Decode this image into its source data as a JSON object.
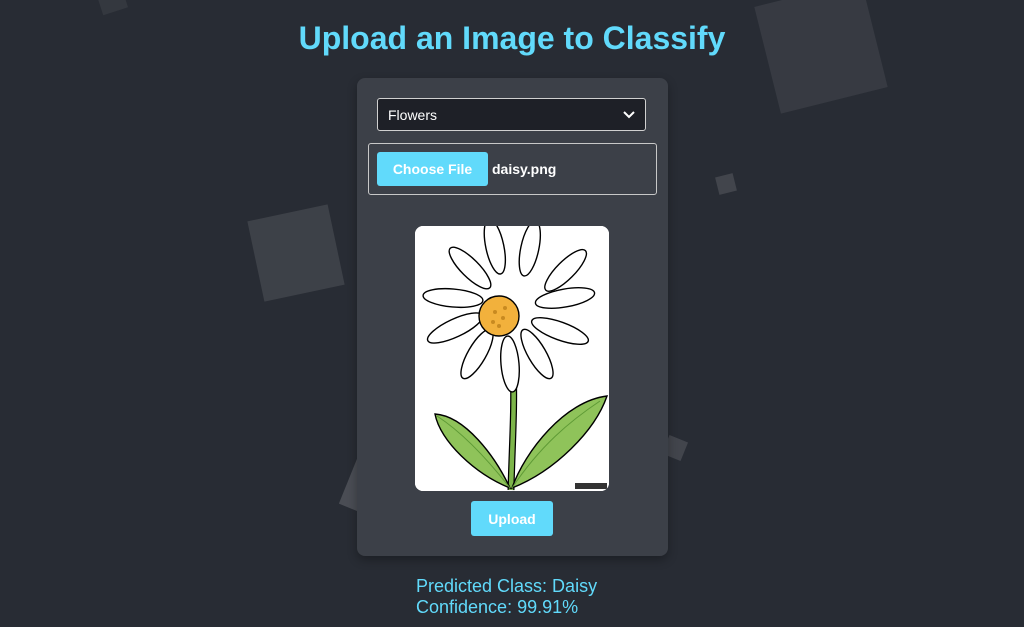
{
  "page": {
    "title": "Upload an Image to Classify"
  },
  "form": {
    "category_selected": "Flowers",
    "choose_file_label": "Choose File",
    "file_name": "daisy.png",
    "upload_label": "Upload"
  },
  "result": {
    "predicted_class": "Predicted Class: Daisy",
    "confidence": "Confidence: 99.91%"
  },
  "icons": {
    "select_arrow": "chevron-down-icon"
  },
  "colors": {
    "accent": "#61dafb",
    "background": "#282c34",
    "panel": "#3c4048"
  }
}
